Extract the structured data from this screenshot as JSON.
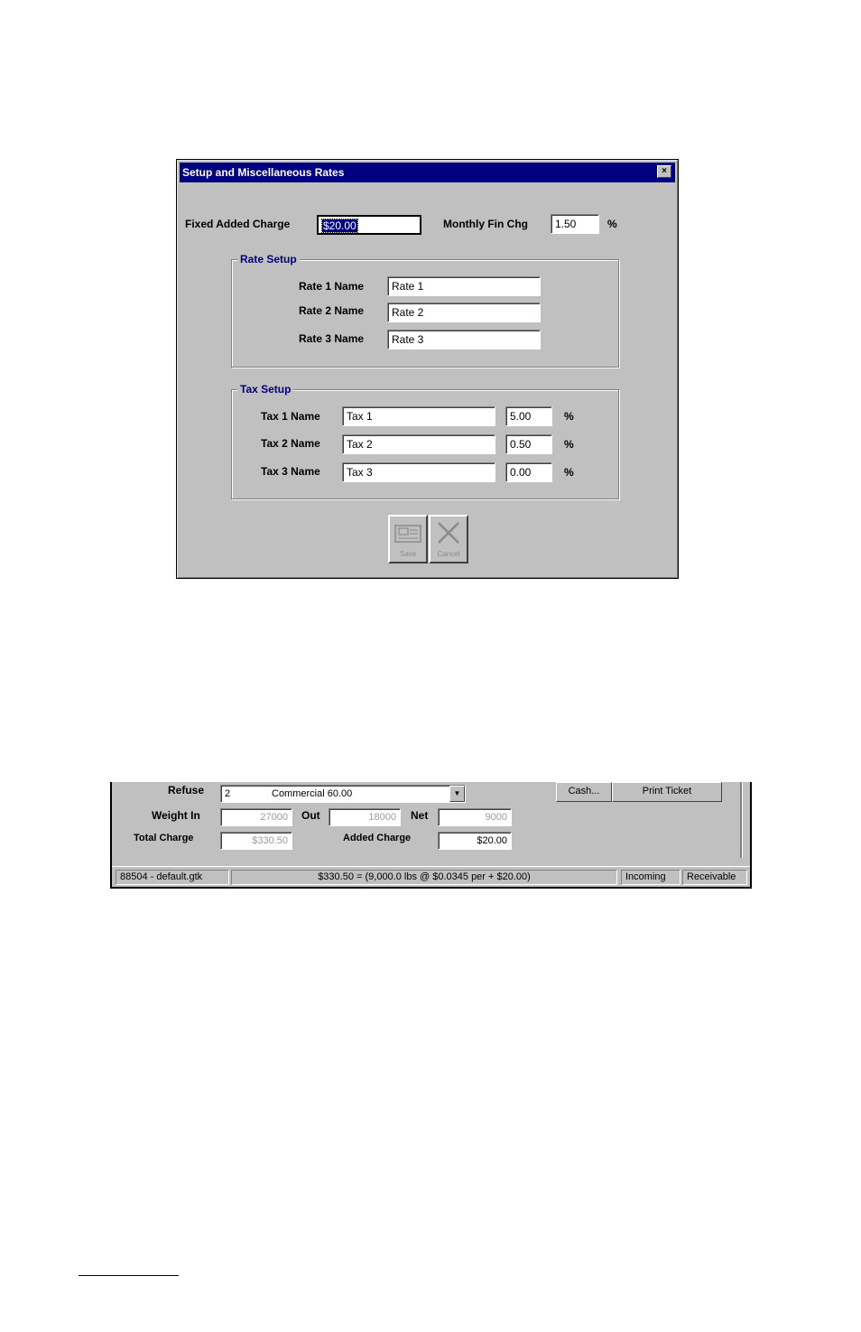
{
  "dialog": {
    "title": "Setup and Miscellaneous Rates",
    "close_glyph": "×",
    "fixed_added_charge": {
      "label": "Fixed Added Charge",
      "value": "$20.00"
    },
    "monthly_fin_chg": {
      "label": "Monthly Fin Chg",
      "value": "1.50",
      "unit": "%"
    },
    "rate_setup": {
      "title": "Rate Setup",
      "rows": [
        {
          "label": "Rate 1 Name",
          "value": "Rate 1"
        },
        {
          "label": "Rate 2 Name",
          "value": "Rate 2"
        },
        {
          "label": "Rate 3 Name",
          "value": "Rate 3"
        }
      ]
    },
    "tax_setup": {
      "title": "Tax Setup",
      "rows": [
        {
          "label": "Tax 1 Name",
          "value": "Tax 1",
          "rate": "5.00",
          "unit": "%"
        },
        {
          "label": "Tax 2 Name",
          "value": "Tax 2",
          "rate": "0.50",
          "unit": "%"
        },
        {
          "label": "Tax 3 Name",
          "value": "Tax 3",
          "rate": "0.00",
          "unit": "%"
        }
      ]
    },
    "buttons": {
      "save": "Save",
      "cancel": "Cancel"
    }
  },
  "ticket": {
    "refuse": {
      "label": "Refuse",
      "code": "2",
      "value": "Commercial 60.00"
    },
    "cash_button": "Cash...",
    "print_ticket_button": "Print Ticket",
    "weight_in": {
      "label": "Weight In",
      "value": "27000"
    },
    "out": {
      "label": "Out",
      "value": "18000"
    },
    "net": {
      "label": "Net",
      "value": "9000"
    },
    "total_charge": {
      "label": "Total Charge",
      "value": "$330.50"
    },
    "added_charge": {
      "label": "Added Charge",
      "value": "$20.00"
    },
    "status_bar": {
      "file": "88504 - default.gtk",
      "formula": "$330.50 = (9,000.0 lbs @ $0.0345 per + $20.00)",
      "direction": "Incoming",
      "account": "Receivable"
    }
  }
}
